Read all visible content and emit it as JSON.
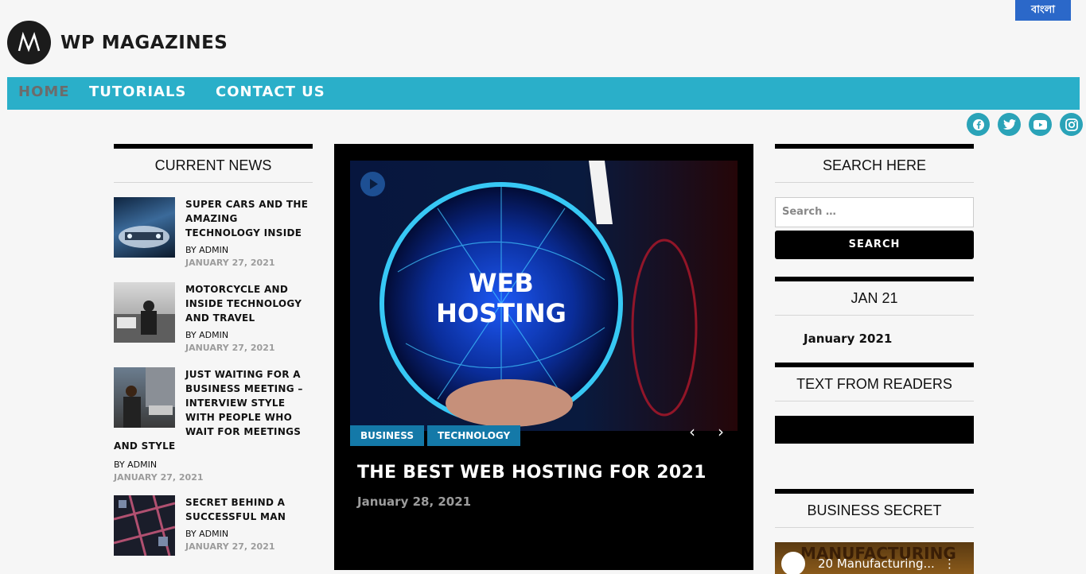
{
  "lang_button": "বাংলা",
  "site": {
    "name": "WP MAGAZINES"
  },
  "nav": [
    "HOME",
    "TUTORIALS",
    "CONTACT US"
  ],
  "social": [
    "facebook-icon",
    "twitter-icon",
    "youtube-icon",
    "instagram-icon"
  ],
  "left": {
    "title": "CURRENT NEWS",
    "posts": [
      {
        "title": "SUPER CARS AND THE AMAZING TECHNOLOGY INSIDE",
        "author": "BY ADMIN",
        "date": "JANUARY 27, 2021"
      },
      {
        "title": "MOTORCYCLE AND INSIDE TECHNOLOGY AND TRAVEL",
        "author": "BY ADMIN",
        "date": "JANUARY 27, 2021"
      },
      {
        "title_l1": "JUST WAITING FOR A",
        "title_l2": "BUSINESS MEETING –",
        "title_l3": "INTERVIEW STYLE",
        "title_l4": "WITH PEOPLE WHO",
        "title_l5": "WAIT FOR MEETINGS",
        "title_l6": "AND STYLE",
        "author": "BY ADMIN",
        "date": "JANUARY 27, 2021"
      },
      {
        "title": "SECRET BEHIND A SUCCESSFUL MAN",
        "author": "BY ADMIN",
        "date": "JANUARY 27, 2021"
      }
    ]
  },
  "feature": {
    "image_text_1": "WEB",
    "image_text_2": "HOSTING",
    "categories": [
      "BUSINESS",
      "TECHNOLOGY"
    ],
    "title": "THE BEST WEB HOSTING FOR 2021",
    "date": "January 28, 2021"
  },
  "right": {
    "search_title": "SEARCH HERE",
    "search_placeholder": "Search …",
    "search_button": "SEARCH",
    "archive_title": "JAN 21",
    "archive_link": "January 2021",
    "readers_title": "TEXT FROM READERS",
    "business_title": "BUSINESS SECRET",
    "video_title": "20 Manufacturing...",
    "video_banner": "MANUFACTURING"
  },
  "colors": {
    "nav": "#2aafc9",
    "category": "#1479a8",
    "lang": "#2b68c9",
    "social": "#2aa3b8"
  }
}
